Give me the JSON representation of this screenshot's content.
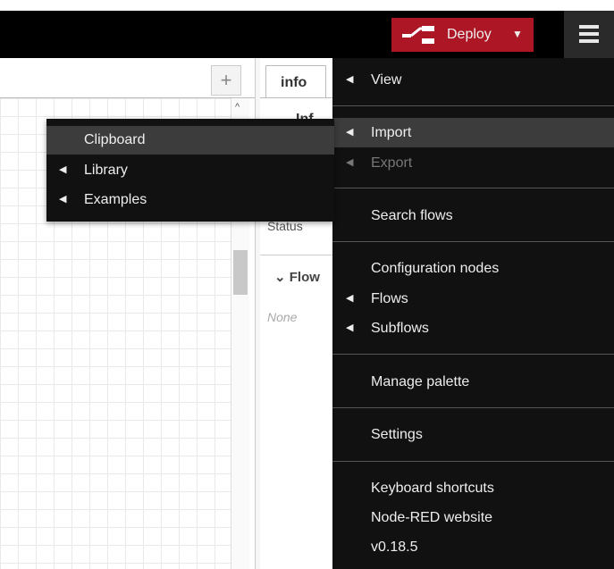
{
  "header": {
    "deploy_label": "Deploy",
    "deploy_color": "#ad1625",
    "menu_icon": "hamburger-menu-icon"
  },
  "workspace": {
    "add_tab_label": "+"
  },
  "sidebar": {
    "tab_label": "info",
    "info_heading_fragment": "Inf",
    "status_label": "Status",
    "flows_section": "Flow",
    "flows_value": "None"
  },
  "menu": {
    "items": [
      {
        "label": "View",
        "has_submenu": true
      },
      {
        "label": "Import",
        "has_submenu": true,
        "active": true
      },
      {
        "label": "Export",
        "has_submenu": true,
        "disabled": true
      },
      {
        "label": "Search flows"
      },
      {
        "label": "Configuration nodes"
      },
      {
        "label": "Flows",
        "has_submenu": true
      },
      {
        "label": "Subflows",
        "has_submenu": true
      },
      {
        "label": "Manage palette"
      },
      {
        "label": "Settings"
      },
      {
        "label": "Keyboard shortcuts"
      },
      {
        "label": "Node-RED website"
      },
      {
        "label": "v0.18.5"
      }
    ]
  },
  "import_submenu": {
    "items": [
      {
        "label": "Clipboard",
        "active": true
      },
      {
        "label": "Library",
        "has_submenu": true
      },
      {
        "label": "Examples",
        "has_submenu": true
      }
    ]
  }
}
